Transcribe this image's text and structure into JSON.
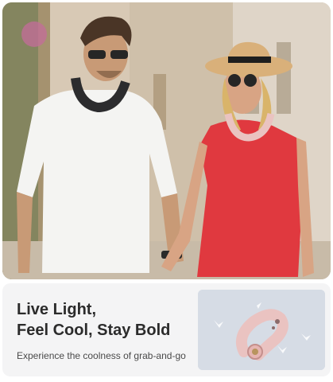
{
  "headline": {
    "line1": "Live Light,",
    "line2": "Feel Cool, Stay Bold"
  },
  "tagline": "Experience the coolness of grab-and-go",
  "colors": {
    "dress": "#e0393f",
    "shirt": "#f4f4f2",
    "fan_pink": "#eac3c1",
    "fan_dark": "#2c2c2e",
    "card_bg": "#f4f4f5",
    "headline_text": "#2b2b2b"
  },
  "icons": {
    "product": "neck-fan-icon"
  }
}
